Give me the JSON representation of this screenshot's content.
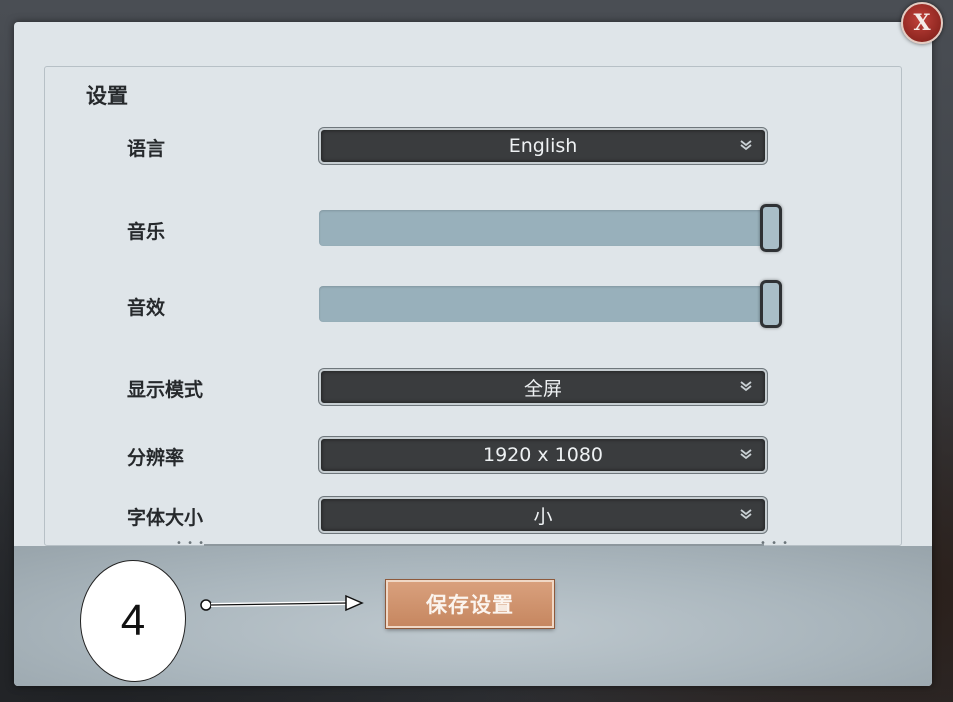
{
  "window": {
    "title": "设置",
    "close_label": "X"
  },
  "settings": [
    {
      "label": "语言",
      "type": "dropdown",
      "value": "English"
    },
    {
      "label": "音乐",
      "type": "slider",
      "level": 1.0
    },
    {
      "label": "音效",
      "type": "slider",
      "level": 1.0
    },
    {
      "label": "显示模式",
      "type": "dropdown",
      "value": "全屏"
    },
    {
      "label": "分辨率",
      "type": "dropdown",
      "value": "1920 x 1080"
    },
    {
      "label": "字体大小",
      "type": "dropdown",
      "value": "小"
    }
  ],
  "actions": {
    "save_label": "保存设置"
  },
  "annotation": {
    "step_number": "4"
  },
  "icons": {
    "close": "close-icon",
    "dropdown": "chevron-down-icon"
  },
  "colors": {
    "panel": "#dfe5e9",
    "dropdown_bg": "#3a3c3e",
    "slider_fill": "#98b0bb",
    "save_button": "#d09473",
    "close_button": "#a8322b"
  }
}
